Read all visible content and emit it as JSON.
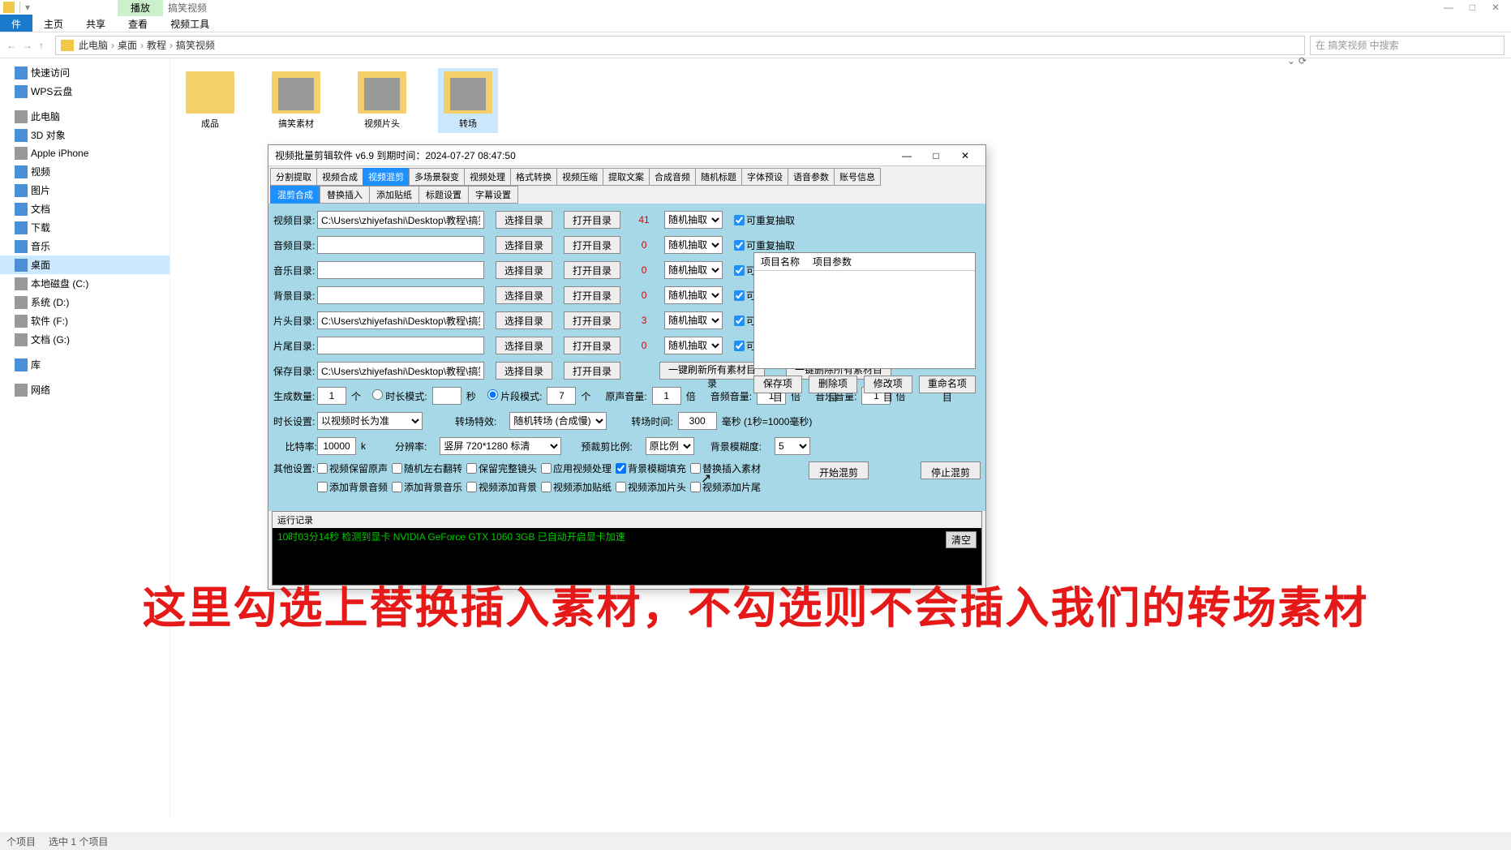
{
  "explorer": {
    "titlebar": {
      "play_tab": "播放",
      "title": "搞笑视频"
    },
    "ribbon": [
      "件",
      "主页",
      "共享",
      "查看",
      "视频工具"
    ],
    "breadcrumb": [
      "此电脑",
      "桌面",
      "教程",
      "搞笑视频"
    ],
    "search_placeholder": "在 搞笑视频 中搜索",
    "sidebar": [
      {
        "label": "快速访问",
        "ic": "blue"
      },
      {
        "label": "WPS云盘",
        "ic": "blue"
      },
      {
        "sep": true
      },
      {
        "label": "此电脑",
        "ic": "gray"
      },
      {
        "label": "3D 对象",
        "ic": "blue"
      },
      {
        "label": "Apple iPhone",
        "ic": "gray"
      },
      {
        "label": "视频",
        "ic": "blue"
      },
      {
        "label": "图片",
        "ic": "blue"
      },
      {
        "label": "文档",
        "ic": "blue"
      },
      {
        "label": "下载",
        "ic": "blue"
      },
      {
        "label": "音乐",
        "ic": "blue"
      },
      {
        "label": "桌面",
        "ic": "blue",
        "selected": true
      },
      {
        "label": "本地磁盘 (C:)",
        "ic": "gray"
      },
      {
        "label": "系统 (D:)",
        "ic": "gray"
      },
      {
        "label": "软件 (F:)",
        "ic": "gray"
      },
      {
        "label": "文档 (G:)",
        "ic": "gray"
      },
      {
        "sep": true
      },
      {
        "label": "库",
        "ic": "blue"
      },
      {
        "sep": true
      },
      {
        "label": "网络",
        "ic": "gray"
      }
    ],
    "folders": [
      {
        "label": "成品"
      },
      {
        "label": "搞笑素材",
        "thumb": true
      },
      {
        "label": "视频片头",
        "thumb": true
      },
      {
        "label": "转场",
        "thumb": true,
        "selected": true
      }
    ],
    "status": {
      "count": "个项目",
      "sel": "选中 1 个项目"
    }
  },
  "dialog": {
    "title": "视频批量剪辑软件 v6.9      到期时间：2024-07-27 08:47:50",
    "main_tabs": [
      "分割提取",
      "视频合成",
      "视频混剪",
      "多场景裂变",
      "视频处理",
      "格式转换",
      "视频压缩",
      "提取文案",
      "合成音频",
      "随机标题",
      "字体预设",
      "语音参数",
      "账号信息"
    ],
    "main_active": 2,
    "sub_tabs": [
      "混剪合成",
      "替换插入",
      "添加贴纸",
      "标题设置",
      "字幕设置"
    ],
    "sub_active": 0,
    "rows": {
      "video": {
        "lbl": "视频目录:",
        "path": "C:\\Users\\zhiyefashi\\Desktop\\教程\\搞笑视频\\搞",
        "count": "41",
        "mode": "随机抽取",
        "repeat": "可重复抽取"
      },
      "audio": {
        "lbl": "音频目录:",
        "path": "",
        "count": "0",
        "mode": "随机抽取",
        "repeat": "可重复抽取"
      },
      "music": {
        "lbl": "音乐目录:",
        "path": "",
        "count": "0",
        "mode": "随机抽取",
        "repeat": "可重复抽取"
      },
      "bg": {
        "lbl": "背景目录:",
        "path": "",
        "count": "0",
        "mode": "随机抽取",
        "repeat": "可重复抽取"
      },
      "head": {
        "lbl": "片头目录:",
        "path": "C:\\Users\\zhiyefashi\\Desktop\\教程\\搞笑视频\\视",
        "count": "3",
        "mode": "随机抽取",
        "repeat": "可重复抽取"
      },
      "tail": {
        "lbl": "片尾目录:",
        "path": "",
        "count": "0",
        "mode": "随机抽取",
        "repeat": "可重复抽取"
      },
      "save": {
        "lbl": "保存目录:",
        "path": "C:\\Users\\zhiyefashi\\Desktop\\教程\\搞笑视频\\成"
      }
    },
    "btn_select": "选择目录",
    "btn_open": "打开目录",
    "project_header": {
      "name": "项目名称",
      "params": "项目参数"
    },
    "proj_btns": [
      "保存项目",
      "删除项目",
      "修改项目",
      "重命名项目"
    ],
    "big_btns": [
      "一键刷新所有素材目录",
      "一键删除所有素材目录"
    ],
    "gen": {
      "lbl": "生成数量:",
      "val": "1",
      "unit": "个",
      "duration_mode": "时长模式:",
      "duration_unit": "秒",
      "segment_mode": "片段模式:",
      "segment_val": "7",
      "segment_unit": "个",
      "orig_vol": "原声音量:",
      "orig_val": "1",
      "vol_unit": "倍",
      "audio_vol": "音频音量:",
      "audio_val": "1",
      "music_vol": "音乐音量:",
      "music_val": "1"
    },
    "dur": {
      "lbl": "时长设置:",
      "val": "以视频时长为准",
      "trans_lbl": "转场特效:",
      "trans_val": "随机转场 (合成慢)",
      "time_lbl": "转场时间:",
      "time_val": "300",
      "time_unit": "毫秒 (1秒=1000毫秒)"
    },
    "rate": {
      "lbl": "比特率:",
      "val": "10000",
      "unit": "k",
      "res_lbl": "分辨率:",
      "res_val": "竖屏  720*1280   标清",
      "crop_lbl": "预裁剪比例:",
      "crop_val": "原比例",
      "blur_lbl": "背景模糊度:",
      "blur_val": "5"
    },
    "other_lbl": "其他设置:",
    "checks": [
      {
        "label": "视频保留原声",
        "c": false
      },
      {
        "label": "随机左右翻转",
        "c": false
      },
      {
        "label": "保留完整镜头",
        "c": false
      },
      {
        "label": "应用视频处理",
        "c": false
      },
      {
        "label": "背景模糊填充",
        "c": true
      },
      {
        "label": "替换插入素材",
        "c": false
      },
      {
        "label": "添加背景音频",
        "c": false
      },
      {
        "label": "添加背景音乐",
        "c": false
      },
      {
        "label": "视频添加背景",
        "c": false
      },
      {
        "label": "视频添加贴纸",
        "c": false
      },
      {
        "label": "视频添加片头",
        "c": false
      },
      {
        "label": "视频添加片尾",
        "c": false
      }
    ],
    "start_btn": "开始混剪",
    "stop_btn": "停止混剪",
    "log_hdr": "运行记录",
    "log_line": "10时03分14秒 检测到显卡 NVIDIA GeForce GTX 1060 3GB 已自动开启显卡加速",
    "clear_btn": "清空"
  },
  "overlay": "这里勾选上替换插入素材，不勾选则不会插入我们的转场素材"
}
